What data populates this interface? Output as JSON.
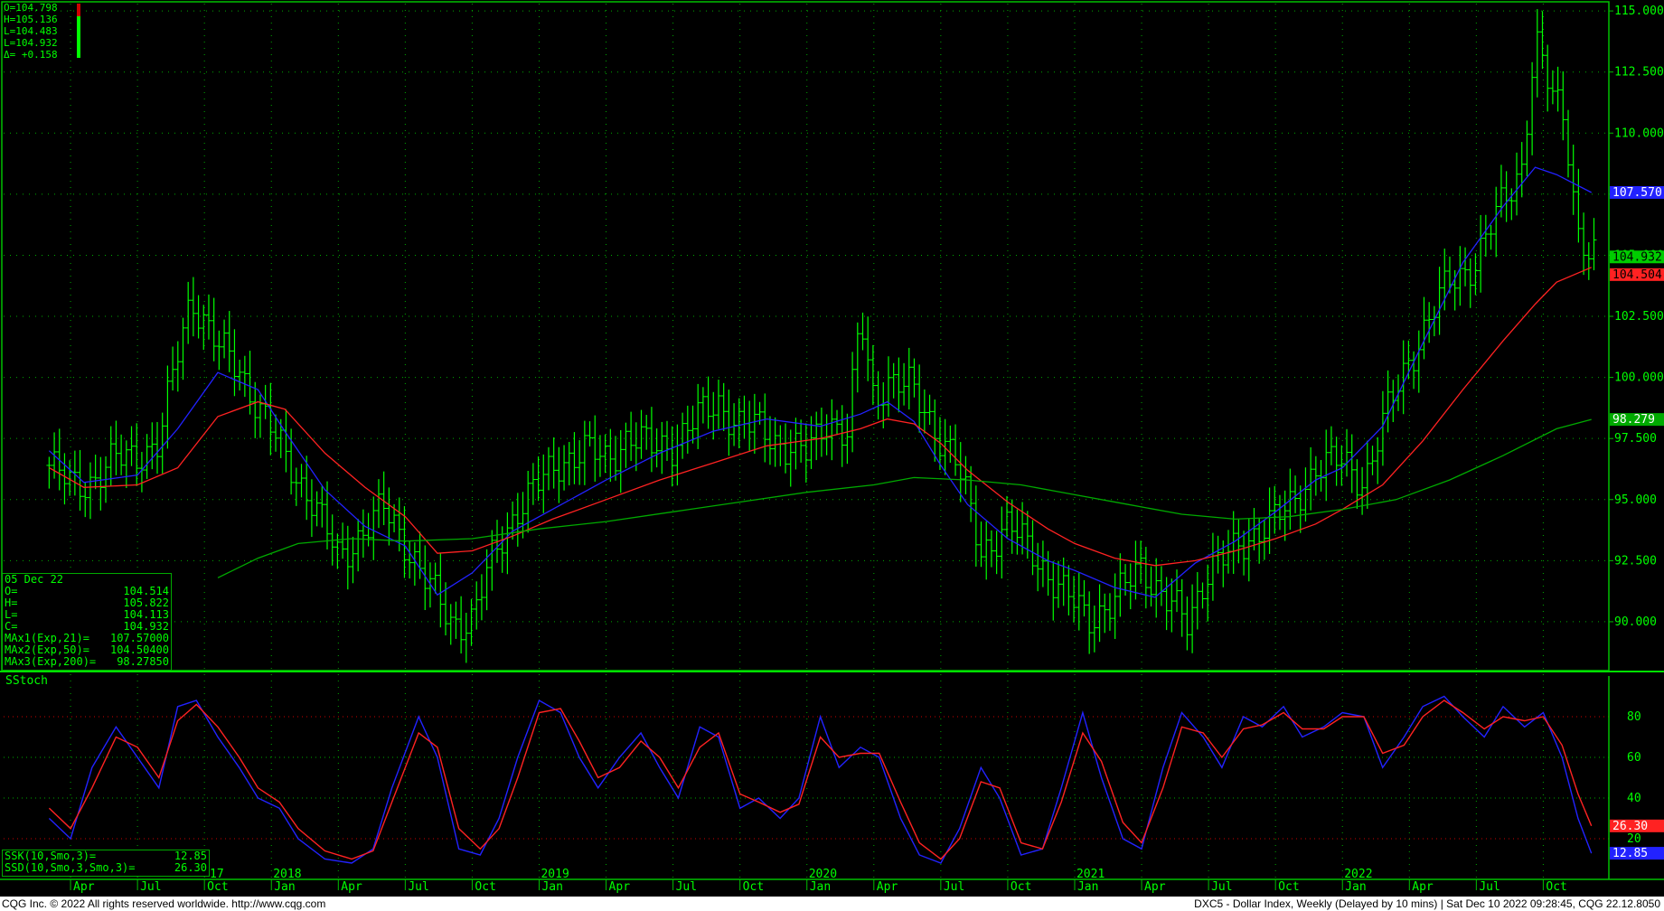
{
  "ohlc_header": {
    "open": "O=104.798",
    "high": "H=105.136",
    "low": "L=104.483",
    "last": "L=104.932",
    "change": "Δ= +0.158"
  },
  "info_box": {
    "date": "05 Dec 22",
    "rows": [
      {
        "label": "O=",
        "value": "104.514"
      },
      {
        "label": "H=",
        "value": "105.822"
      },
      {
        "label": "L=",
        "value": "104.113"
      },
      {
        "label": "C=",
        "value": "104.932"
      },
      {
        "label": "MAx1(Exp,21)=",
        "value": "107.57000"
      },
      {
        "label": "MAx2(Exp,50)=",
        "value": "104.50400"
      },
      {
        "label": "MAx3(Exp,200)=",
        "value": "98.27850"
      }
    ]
  },
  "stoch_panel": {
    "title": "SStoch",
    "ssk_label": "SSK(10,Smo,3)=",
    "ssk_value": "12.85",
    "ssd_label": "SSD(10,Smo,3,Smo,3)=",
    "ssd_value": "26.30",
    "year_marker": "17"
  },
  "footer": {
    "left": "CQG Inc. © 2022 All rights reserved worldwide. http://www.cqg.com",
    "right": "DXC5 - Dollar Index, Weekly (Delayed by 10 mins) | Sat Dec 10 2022 09:28:45, CQG 22.12.8050"
  },
  "colors": {
    "background": "#000000",
    "bars": "#00ff00",
    "ma21": "#2222ff",
    "ma50": "#ff2222",
    "ma200": "#00aa00",
    "grid": "#00aa00",
    "ssk": "#2222ff",
    "ssd": "#ff2222"
  },
  "chart_data": [
    {
      "type": "line",
      "title": "DXC5 - Dollar Index, Weekly",
      "ylim": [
        88,
        115.3
      ],
      "y_ticks": [
        "115.000",
        "112.500",
        "110.000",
        "107.500",
        "105.000",
        "102.500",
        "100.000",
        "97.500",
        "95.000",
        "92.500",
        "90.000"
      ],
      "x_tick_labels": [
        {
          "t": 2017.25,
          "label": "Apr"
        },
        {
          "t": 2017.5,
          "label": "Jul"
        },
        {
          "t": 2017.75,
          "label": "Oct"
        },
        {
          "t": 2018.0,
          "label": "Jan"
        },
        {
          "t": 2018.25,
          "label": "Apr"
        },
        {
          "t": 2018.5,
          "label": "Jul"
        },
        {
          "t": 2018.75,
          "label": "Oct"
        },
        {
          "t": 2019.0,
          "label": "Jan"
        },
        {
          "t": 2019.25,
          "label": "Apr"
        },
        {
          "t": 2019.5,
          "label": "Jul"
        },
        {
          "t": 2019.75,
          "label": "Oct"
        },
        {
          "t": 2020.0,
          "label": "Jan"
        },
        {
          "t": 2020.25,
          "label": "Apr"
        },
        {
          "t": 2020.5,
          "label": "Jul"
        },
        {
          "t": 2020.75,
          "label": "Oct"
        },
        {
          "t": 2021.0,
          "label": "Jan"
        },
        {
          "t": 2021.25,
          "label": "Apr"
        },
        {
          "t": 2021.5,
          "label": "Jul"
        },
        {
          "t": 2021.75,
          "label": "Oct"
        },
        {
          "t": 2022.0,
          "label": "Jan"
        },
        {
          "t": 2022.25,
          "label": "Apr"
        },
        {
          "t": 2022.5,
          "label": "Jul"
        },
        {
          "t": 2022.75,
          "label": "Oct"
        }
      ],
      "year_labels": [
        {
          "t": 2018.0,
          "label": "2018"
        },
        {
          "t": 2019.0,
          "label": "2019"
        },
        {
          "t": 2020.0,
          "label": "2020"
        },
        {
          "t": 2021.0,
          "label": "2021"
        },
        {
          "t": 2022.0,
          "label": "2022"
        }
      ],
      "price_close": {
        "x": [
          2017.17,
          2017.25,
          2017.33,
          2017.42,
          2017.5,
          2017.58,
          2017.65,
          2017.7,
          2017.8,
          2017.88,
          2017.97,
          2018.05,
          2018.15,
          2018.25,
          2018.35,
          2018.42,
          2018.5,
          2018.58,
          2018.67,
          2018.75,
          2018.83,
          2018.92,
          2019.0,
          2019.08,
          2019.17,
          2019.25,
          2019.33,
          2019.42,
          2019.5,
          2019.58,
          2019.67,
          2019.75,
          2019.83,
          2019.92,
          2020.0,
          2020.08,
          2020.15,
          2020.2,
          2020.25,
          2020.3,
          2020.38,
          2020.45,
          2020.55,
          2020.65,
          2020.75,
          2020.85,
          2020.95,
          2021.05,
          2021.15,
          2021.25,
          2021.33,
          2021.42,
          2021.5,
          2021.6,
          2021.7,
          2021.8,
          2021.9,
          2022.0,
          2022.08,
          2022.17,
          2022.25,
          2022.33,
          2022.4,
          2022.5,
          2022.58,
          2022.67,
          2022.72,
          2022.78,
          2022.83,
          2022.88,
          2022.93
        ],
        "y": [
          96.4,
          95.6,
          95.8,
          96.6,
          96.9,
          97.2,
          101.0,
          103.4,
          101.2,
          100.4,
          98.4,
          96.8,
          95.0,
          92.6,
          93.8,
          94.6,
          93.3,
          91.6,
          90.0,
          90.1,
          92.7,
          94.7,
          95.6,
          96.6,
          97.0,
          96.6,
          97.6,
          97.1,
          97.3,
          98.2,
          99.0,
          98.0,
          97.9,
          97.2,
          96.8,
          98.4,
          97.6,
          102.4,
          99.0,
          100.0,
          99.6,
          98.4,
          96.8,
          92.9,
          93.9,
          92.8,
          91.2,
          90.2,
          90.8,
          92.4,
          91.0,
          89.9,
          92.3,
          92.8,
          94.0,
          94.5,
          96.4,
          96.5,
          95.8,
          98.6,
          100.8,
          102.5,
          103.9,
          104.8,
          106.7,
          108.7,
          113.8,
          111.5,
          110.7,
          106.0,
          104.9
        ]
      },
      "series": [
        {
          "name": "MAx1(Exp,21)",
          "x": [
            2017.17,
            2017.3,
            2017.5,
            2017.65,
            2017.8,
            2017.95,
            2018.05,
            2018.2,
            2018.35,
            2018.5,
            2018.62,
            2018.75,
            2018.9,
            2019.05,
            2019.25,
            2019.45,
            2019.65,
            2019.85,
            2020.05,
            2020.2,
            2020.3,
            2020.4,
            2020.5,
            2020.6,
            2020.75,
            2020.9,
            2021.0,
            2021.15,
            2021.3,
            2021.45,
            2021.6,
            2021.75,
            2021.9,
            2022.0,
            2022.15,
            2022.3,
            2022.45,
            2022.6,
            2022.72,
            2022.8,
            2022.93
          ],
          "y": [
            97.0,
            95.7,
            96.0,
            97.9,
            100.2,
            99.5,
            97.8,
            95.4,
            93.9,
            93.1,
            91.1,
            92.0,
            93.7,
            94.6,
            95.8,
            96.9,
            97.8,
            98.3,
            98.0,
            98.5,
            99.0,
            98.2,
            96.4,
            94.8,
            93.4,
            92.5,
            92.1,
            91.4,
            91.0,
            92.4,
            93.3,
            94.5,
            95.8,
            96.3,
            98.0,
            101.4,
            104.7,
            107.0,
            108.6,
            108.3,
            107.57
          ]
        },
        {
          "name": "MAx2(Exp,50)",
          "x": [
            2017.17,
            2017.3,
            2017.5,
            2017.65,
            2017.8,
            2017.95,
            2018.05,
            2018.2,
            2018.35,
            2018.5,
            2018.62,
            2018.75,
            2018.9,
            2019.05,
            2019.25,
            2019.45,
            2019.65,
            2019.85,
            2020.05,
            2020.2,
            2020.3,
            2020.4,
            2020.5,
            2020.6,
            2020.75,
            2020.9,
            2021.0,
            2021.15,
            2021.3,
            2021.45,
            2021.6,
            2021.75,
            2021.9,
            2022.0,
            2022.15,
            2022.3,
            2022.45,
            2022.6,
            2022.72,
            2022.8,
            2022.93
          ],
          "y": [
            96.3,
            95.5,
            95.6,
            96.3,
            98.4,
            99.0,
            98.7,
            96.9,
            95.5,
            94.3,
            92.8,
            92.9,
            93.5,
            94.2,
            95.0,
            95.8,
            96.5,
            97.2,
            97.5,
            97.9,
            98.3,
            98.1,
            97.3,
            96.2,
            94.9,
            93.8,
            93.2,
            92.6,
            92.3,
            92.5,
            92.9,
            93.4,
            94.0,
            94.6,
            95.6,
            97.4,
            99.5,
            101.5,
            103.0,
            103.9,
            104.504
          ]
        },
        {
          "name": "MAx3(Exp,200)",
          "x": [
            2017.8,
            2017.95,
            2018.1,
            2018.3,
            2018.5,
            2018.75,
            2019.0,
            2019.25,
            2019.5,
            2019.75,
            2020.0,
            2020.25,
            2020.4,
            2020.6,
            2020.8,
            2021.0,
            2021.2,
            2021.4,
            2021.6,
            2021.8,
            2022.0,
            2022.2,
            2022.4,
            2022.6,
            2022.8,
            2022.93
          ],
          "y": [
            91.8,
            92.6,
            93.2,
            93.4,
            93.3,
            93.4,
            93.8,
            94.1,
            94.5,
            94.9,
            95.3,
            95.6,
            95.9,
            95.8,
            95.6,
            95.2,
            94.8,
            94.4,
            94.2,
            94.3,
            94.6,
            95.0,
            95.8,
            96.8,
            97.9,
            98.2785
          ]
        }
      ]
    },
    {
      "type": "line",
      "title": "SStoch",
      "ylim": [
        0,
        100
      ],
      "y_ticks": [
        "80",
        "60",
        "40",
        "20"
      ],
      "series": [
        {
          "name": "SSK(10,Smo,3)",
          "x": [
            2017.17,
            2017.25,
            2017.33,
            2017.42,
            2017.5,
            2017.58,
            2017.65,
            2017.72,
            2017.8,
            2017.88,
            2017.95,
            2018.03,
            2018.1,
            2018.2,
            2018.3,
            2018.38,
            2018.45,
            2018.55,
            2018.62,
            2018.7,
            2018.78,
            2018.85,
            2018.92,
            2019.0,
            2019.08,
            2019.15,
            2019.22,
            2019.3,
            2019.38,
            2019.45,
            2019.52,
            2019.6,
            2019.67,
            2019.75,
            2019.82,
            2019.9,
            2019.97,
            2020.05,
            2020.12,
            2020.2,
            2020.27,
            2020.35,
            2020.42,
            2020.5,
            2020.57,
            2020.65,
            2020.72,
            2020.8,
            2020.88,
            2020.95,
            2021.03,
            2021.1,
            2021.18,
            2021.25,
            2021.33,
            2021.4,
            2021.48,
            2021.55,
            2021.63,
            2021.7,
            2021.78,
            2021.85,
            2021.93,
            2022.0,
            2022.08,
            2022.15,
            2022.23,
            2022.3,
            2022.38,
            2022.45,
            2022.53,
            2022.6,
            2022.68,
            2022.75,
            2022.82,
            2022.88,
            2022.93
          ],
          "y": [
            30,
            20,
            55,
            75,
            60,
            45,
            85,
            88,
            70,
            55,
            40,
            35,
            20,
            10,
            8,
            15,
            45,
            80,
            60,
            15,
            12,
            30,
            60,
            88,
            82,
            60,
            45,
            60,
            72,
            55,
            40,
            75,
            70,
            35,
            40,
            30,
            40,
            80,
            55,
            65,
            60,
            30,
            12,
            8,
            25,
            55,
            40,
            12,
            15,
            45,
            82,
            50,
            20,
            15,
            55,
            82,
            70,
            55,
            80,
            75,
            85,
            70,
            75,
            82,
            80,
            55,
            70,
            85,
            90,
            80,
            70,
            85,
            75,
            82,
            60,
            30,
            12.85
          ]
        },
        {
          "name": "SSD(10,Smo,3,Smo,3)",
          "x": [
            2017.17,
            2017.25,
            2017.33,
            2017.42,
            2017.5,
            2017.58,
            2017.65,
            2017.72,
            2017.8,
            2017.88,
            2017.95,
            2018.03,
            2018.1,
            2018.2,
            2018.3,
            2018.38,
            2018.45,
            2018.55,
            2018.62,
            2018.7,
            2018.78,
            2018.85,
            2018.92,
            2019.0,
            2019.08,
            2019.15,
            2019.22,
            2019.3,
            2019.38,
            2019.45,
            2019.52,
            2019.6,
            2019.67,
            2019.75,
            2019.82,
            2019.9,
            2019.97,
            2020.05,
            2020.12,
            2020.2,
            2020.27,
            2020.35,
            2020.42,
            2020.5,
            2020.57,
            2020.65,
            2020.72,
            2020.8,
            2020.88,
            2020.95,
            2021.03,
            2021.1,
            2021.18,
            2021.25,
            2021.33,
            2021.4,
            2021.48,
            2021.55,
            2021.63,
            2021.7,
            2021.78,
            2021.85,
            2021.93,
            2022.0,
            2022.08,
            2022.15,
            2022.23,
            2022.3,
            2022.38,
            2022.45,
            2022.53,
            2022.6,
            2022.68,
            2022.75,
            2022.82,
            2022.88,
            2022.93
          ],
          "y": [
            35,
            25,
            45,
            70,
            65,
            50,
            78,
            86,
            75,
            60,
            45,
            38,
            25,
            14,
            10,
            14,
            38,
            72,
            65,
            25,
            15,
            25,
            50,
            82,
            84,
            68,
            50,
            55,
            68,
            60,
            45,
            65,
            72,
            42,
            38,
            33,
            37,
            70,
            60,
            62,
            62,
            38,
            18,
            10,
            20,
            48,
            45,
            18,
            15,
            38,
            72,
            58,
            28,
            18,
            45,
            75,
            72,
            60,
            74,
            76,
            82,
            74,
            74,
            80,
            80,
            62,
            66,
            80,
            88,
            82,
            74,
            80,
            78,
            80,
            66,
            42,
            26.3
          ]
        }
      ]
    }
  ],
  "axis_tags": {
    "price_current": "104.932",
    "ma21": "107.570",
    "ma50": "104.504",
    "ma200": "98.279",
    "ssd": "26.30",
    "ssk": "12.85"
  }
}
